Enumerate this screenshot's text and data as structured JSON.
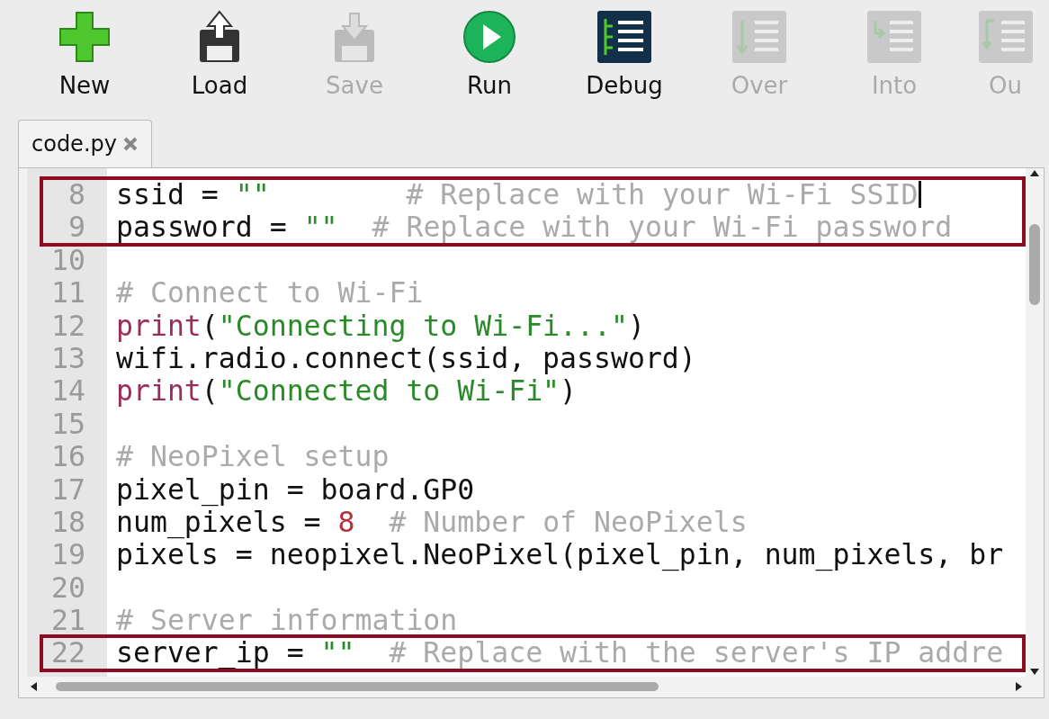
{
  "toolbar": [
    {
      "label": "New",
      "kind": "new",
      "disabled": false
    },
    {
      "label": "Load",
      "kind": "load",
      "disabled": false
    },
    {
      "label": "Save",
      "kind": "save",
      "disabled": true
    },
    {
      "label": "Run",
      "kind": "run",
      "disabled": false
    },
    {
      "label": "Debug",
      "kind": "debug",
      "disabled": false
    },
    {
      "label": "Over",
      "kind": "over",
      "disabled": true
    },
    {
      "label": "Into",
      "kind": "into",
      "disabled": true
    },
    {
      "label": "Ou",
      "kind": "out",
      "disabled": true
    }
  ],
  "tabs": [
    {
      "label": "code.py",
      "selected": true
    }
  ],
  "editor": {
    "lines": [
      {
        "number": "8",
        "highlighted": true,
        "caret": true,
        "tokens": [
          {
            "kind": "plain",
            "text": "ssid = "
          },
          {
            "kind": "string",
            "text": "\"\""
          },
          {
            "kind": "comment",
            "text": "        # Replace with your Wi-Fi SSID"
          }
        ]
      },
      {
        "number": "9",
        "highlighted": true,
        "caret": false,
        "tokens": [
          {
            "kind": "plain",
            "text": "password = "
          },
          {
            "kind": "string",
            "text": "\"\""
          },
          {
            "kind": "comment",
            "text": "  # Replace with your Wi-Fi password"
          }
        ]
      },
      {
        "number": "10",
        "highlighted": false,
        "caret": false
      },
      {
        "number": "11",
        "highlighted": false,
        "caret": false,
        "tokens": [
          {
            "kind": "comment",
            "text": "# Connect to Wi-Fi"
          }
        ]
      },
      {
        "number": "12",
        "highlighted": false,
        "caret": false,
        "tokens": [
          {
            "kind": "keyword",
            "text": "print"
          },
          {
            "kind": "plain",
            "text": "("
          },
          {
            "kind": "string",
            "text": "\"Connecting to Wi-Fi...\""
          },
          {
            "kind": "plain",
            "text": ")"
          }
        ]
      },
      {
        "number": "13",
        "highlighted": false,
        "caret": false,
        "tokens": [
          {
            "kind": "plain",
            "text": "wifi.radio.connect(ssid, password)"
          }
        ]
      },
      {
        "number": "14",
        "highlighted": false,
        "caret": false,
        "tokens": [
          {
            "kind": "keyword",
            "text": "print"
          },
          {
            "kind": "plain",
            "text": "("
          },
          {
            "kind": "string",
            "text": "\"Connected to Wi-Fi\""
          },
          {
            "kind": "plain",
            "text": ")"
          }
        ]
      },
      {
        "number": "15",
        "highlighted": false,
        "caret": false
      },
      {
        "number": "16",
        "highlighted": false,
        "caret": false,
        "tokens": [
          {
            "kind": "comment",
            "text": "# NeoPixel setup"
          }
        ]
      },
      {
        "number": "17",
        "highlighted": false,
        "caret": false,
        "tokens": [
          {
            "kind": "plain",
            "text": "pixel_pin = board.GP0"
          }
        ]
      },
      {
        "number": "18",
        "highlighted": false,
        "caret": false,
        "tokens": [
          {
            "kind": "plain",
            "text": "num_pixels = "
          },
          {
            "kind": "number",
            "text": "8"
          },
          {
            "kind": "comment",
            "text": "  # Number of NeoPixels"
          }
        ]
      },
      {
        "number": "19",
        "highlighted": false,
        "caret": false,
        "tokens": [
          {
            "kind": "plain",
            "text": "pixels = neopixel.NeoPixel(pixel_pin, num_pixels, br"
          }
        ]
      },
      {
        "number": "20",
        "highlighted": false,
        "caret": false
      },
      {
        "number": "21",
        "highlighted": false,
        "caret": false,
        "tokens": [
          {
            "kind": "comment",
            "text": "# Server information"
          }
        ]
      },
      {
        "number": "22",
        "highlighted": true,
        "caret": false,
        "tokens": [
          {
            "kind": "plain",
            "text": "server_ip = "
          },
          {
            "kind": "string",
            "text": "\"\""
          },
          {
            "kind": "comment",
            "text": "  # Replace with the server's IP addre"
          }
        ]
      }
    ]
  }
}
